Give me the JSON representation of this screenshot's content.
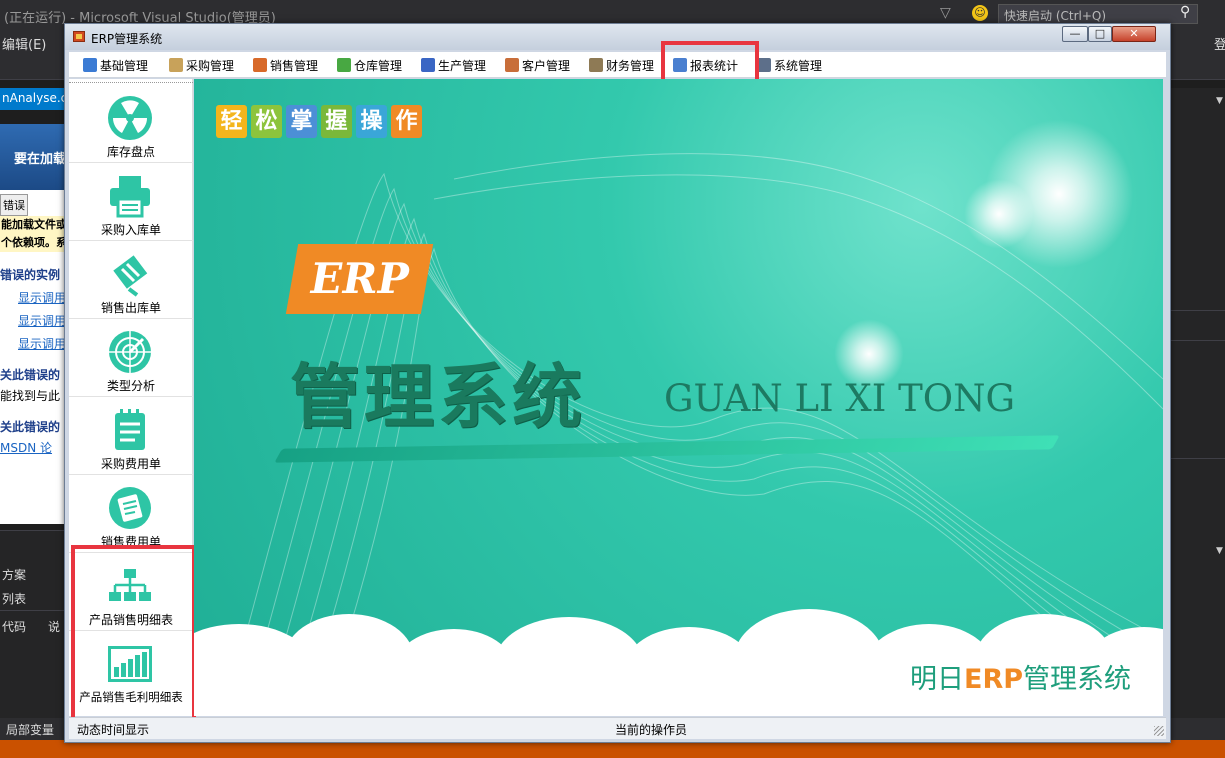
{
  "vs": {
    "title": "(正在运行) - Microsoft Visual Studio(管理员)",
    "quick_launch": "快速启动 (Ctrl+Q)",
    "menu_edit": "编辑(E)",
    "menu_login": "登",
    "doc_tab": "nAnalyse.cs",
    "err_banner": "要在加载",
    "err_tab": "错误",
    "err_line1": "能加载文件或",
    "err_line2": "个依赖项。系",
    "err_h1": "错误的实例",
    "err_link1": "显示调用",
    "err_link2": "显示调用",
    "err_link3": "显示调用",
    "err_h2": "关此错误的",
    "err_p2": "能找到与此",
    "err_h3": "关此错误的",
    "err_p3": "MSDN 论",
    "bottom_solution": "方案",
    "bottom_list": "列表",
    "bottom_code": "代码",
    "bottom_desc": "说",
    "status_locals": "局部变量"
  },
  "window": {
    "title": "ERP管理系统",
    "min": "—",
    "max": "□",
    "close": "✕"
  },
  "menu": [
    {
      "label": "基础管理",
      "color": "#3b7bd4"
    },
    {
      "label": "采购管理",
      "color": "#c8a25a"
    },
    {
      "label": "销售管理",
      "color": "#d86a2a"
    },
    {
      "label": "仓库管理",
      "color": "#48a842"
    },
    {
      "label": "生产管理",
      "color": "#3a66c4"
    },
    {
      "label": "客户管理",
      "color": "#c86e3a"
    },
    {
      "label": "财务管理",
      "color": "#8e7a55"
    },
    {
      "label": "报表统计",
      "color": "#4a7fd0"
    },
    {
      "label": "系统管理",
      "color": "#5d6f8a"
    }
  ],
  "sidebar": [
    {
      "label": "库存盘点",
      "icon": "radiation-icon"
    },
    {
      "label": "采购入库单",
      "icon": "printer-icon"
    },
    {
      "label": "销售出库单",
      "icon": "tag-icon"
    },
    {
      "label": "类型分析",
      "icon": "radar-icon"
    },
    {
      "label": "采购费用单",
      "icon": "notepad-icon"
    },
    {
      "label": "销售费用单",
      "icon": "document-icon"
    },
    {
      "label": "产品销售明细表",
      "icon": "org-chart-icon"
    },
    {
      "label": "产品销售毛利明细表",
      "icon": "bar-chart-icon"
    }
  ],
  "banner": {
    "tags": [
      "轻",
      "松",
      "掌",
      "握",
      "操",
      "作"
    ],
    "tag_colors": [
      "#f3b51c",
      "#8dc43c",
      "#4c8fd6",
      "#7ab83a",
      "#3aa6d8",
      "#f08a25"
    ],
    "erp": "ERP",
    "title_cn": "管理系统",
    "title_en": "GUAN LI XI TONG",
    "brand_prefix": "明日",
    "brand_erp": "ERP",
    "brand_suffix": "管理系统"
  },
  "status": {
    "left": "动态时间显示",
    "center": "当前的操作员"
  },
  "colors": {
    "teal": "#2fc3a6",
    "highlight": "#e8353f",
    "orange": "#f08a25"
  }
}
